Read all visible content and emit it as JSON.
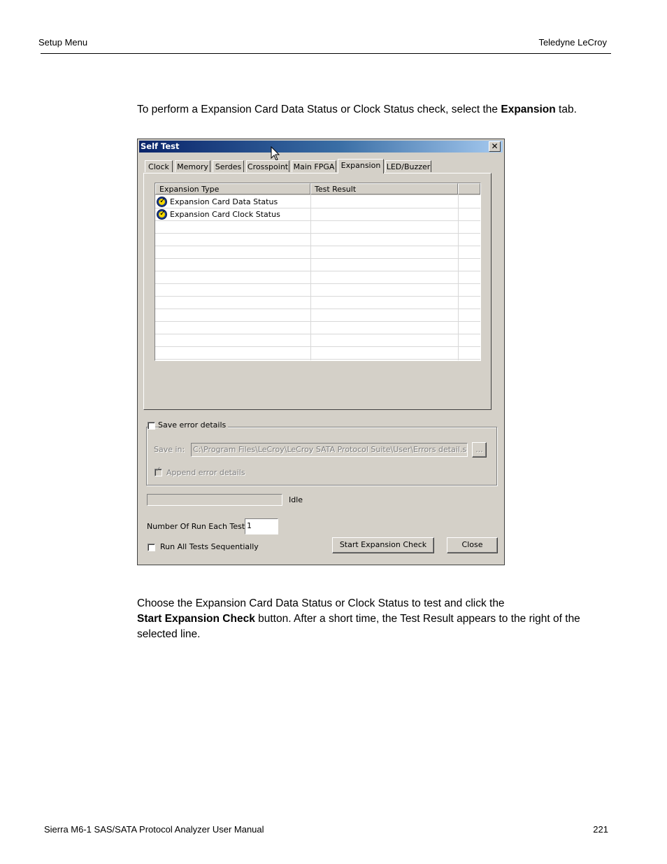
{
  "header": {
    "left": "Setup Menu",
    "right": "Teledyne LeCroy"
  },
  "intro": {
    "prefix": "To perform a Expansion Card Data Status or Clock Status check, select the ",
    "bold": "Expansion",
    "suffix": " tab."
  },
  "dialog": {
    "title": "Self Test",
    "close_glyph": "✕",
    "tabs": [
      "Clock",
      "Memory",
      "Serdes",
      "Crosspoint",
      "Main FPGA",
      "Expansion",
      "LED/Buzzer"
    ],
    "active_tab": "Expansion",
    "list": {
      "columns": [
        "Expansion Type",
        "Test Result"
      ],
      "rows": [
        {
          "label": "Expansion Card Data Status",
          "result": ""
        },
        {
          "label": "Expansion Card Clock Status",
          "result": ""
        }
      ]
    },
    "save_error_details": "Save error details",
    "save_in_label": "Save in:",
    "save_in_path": "C:\\Program Files\\LeCroy\\LeCroy SATA Protocol Suite\\User\\Errors detail.slf",
    "browse_label": "...",
    "append_error_details": "Append error details",
    "status": "Idle",
    "progress_percent": 0,
    "run_count_label": "Number Of Run Each Test:",
    "run_count_value": "1",
    "run_all_label": "Run All Tests Sequentially",
    "start_button": "Start Expansion Check",
    "close_button": "Close"
  },
  "body2": {
    "line1": "Choose the Expansion Card Data Status or Clock Status to test and click the",
    "bold": "Start Expansion Check",
    "rest": " button. After a short time, the Test Result appears to the right of the selected line."
  },
  "footer": {
    "left": "Sierra M6-1 SAS/SATA Protocol Analyzer User Manual",
    "right": "221"
  }
}
